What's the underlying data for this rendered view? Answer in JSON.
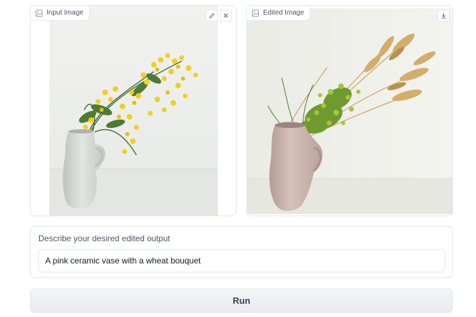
{
  "input_panel": {
    "label": "Input Image",
    "label_icon": "image-icon",
    "tools": [
      "edit-icon",
      "close-icon"
    ],
    "image": "White ceramic pitcher vase holding yellow mimosa flowers"
  },
  "output_panel": {
    "label": "Edited Image",
    "label_icon": "image-icon",
    "tools": [
      "download-icon"
    ],
    "image": "Pink ceramic pitcher vase holding dried wheat and green grass bouquet"
  },
  "prompt": {
    "label": "Describe your desired edited output",
    "value": "A pink ceramic vase with a wheat bouquet"
  },
  "run_button": {
    "label": "Run"
  },
  "colors": {
    "border": "#e5e7eb",
    "text_muted": "#4b5563",
    "mimosa_yellow": "#f2d01c",
    "wheat": "#d3ad6c",
    "vase_pink": "#cbb3ad",
    "vase_white": "#d6d8d6"
  }
}
